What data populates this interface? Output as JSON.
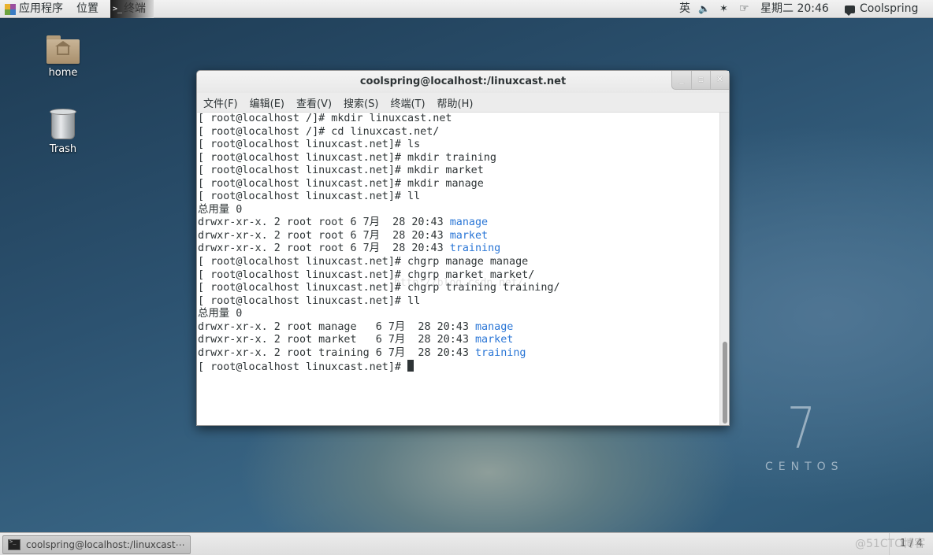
{
  "topbar": {
    "applications": "应用程序",
    "places": "位置",
    "terminal_tab": "终端",
    "input_method": "英",
    "volume_icon": "speaker-muted-icon",
    "bluetooth_icon": "bluetooth-icon",
    "network_icon": "network-icon",
    "clock": "星期二 20:46",
    "user": "Coolspring"
  },
  "desktop": {
    "icons": [
      {
        "label": "home",
        "icon": "home-folder-icon"
      },
      {
        "label": "Trash",
        "icon": "trash-icon"
      }
    ],
    "logo_number": "7",
    "logo_word": "CENTOS"
  },
  "window": {
    "title": "coolspring@localhost:/linuxcast.net",
    "controls": {
      "minimize": "_",
      "maximize": "▫",
      "close": "✕"
    },
    "menu": [
      "文件(F)",
      "编辑(E)",
      "查看(V)",
      "搜索(S)",
      "终端(T)",
      "帮助(H)"
    ]
  },
  "terminal": {
    "lines": [
      {
        "text": "[ root@localhost /]# mkdir linuxcast.net"
      },
      {
        "text": "[ root@localhost /]# cd linuxcast.net/"
      },
      {
        "text": "[ root@localhost linuxcast.net]# ls"
      },
      {
        "text": "[ root@localhost linuxcast.net]# mkdir training"
      },
      {
        "text": "[ root@localhost linuxcast.net]# mkdir market"
      },
      {
        "text": "[ root@localhost linuxcast.net]# mkdir manage"
      },
      {
        "text": "[ root@localhost linuxcast.net]# ll"
      },
      {
        "text": "总用量 0"
      },
      {
        "text": "drwxr-xr-x. 2 root root 6 7月  28 20:43 ",
        "dir": "manage"
      },
      {
        "text": "drwxr-xr-x. 2 root root 6 7月  28 20:43 ",
        "dir": "market"
      },
      {
        "text": "drwxr-xr-x. 2 root root 6 7月  28 20:43 ",
        "dir": "training"
      },
      {
        "text": "[ root@localhost linuxcast.net]# chgrp manage manage"
      },
      {
        "text": "[ root@localhost linuxcast.net]# chgrp market market/"
      },
      {
        "text": "[ root@localhost linuxcast.net]# chgrp training training/"
      },
      {
        "text": "[ root@localhost linuxcast.net]# ll"
      },
      {
        "text": "总用量 0"
      },
      {
        "text": "drwxr-xr-x. 2 root manage   6 7月  28 20:43 ",
        "dir": "manage"
      },
      {
        "text": "drwxr-xr-x. 2 root market   6 7月  28 20:43 ",
        "dir": "market"
      },
      {
        "text": "drwxr-xr-x. 2 root training 6 7月  28 20:43 ",
        "dir": "training"
      },
      {
        "text": "[ root@localhost linuxcast.net]# ",
        "cursor": true
      }
    ],
    "dir_color": "#2a76d6",
    "url_watermark": "http://blog.csdn.net/"
  },
  "taskbar": {
    "task_label": "coolspring@localhost:/linuxcast⋯",
    "workspace": "1 / 4",
    "watermark": "@51CTO博客"
  }
}
